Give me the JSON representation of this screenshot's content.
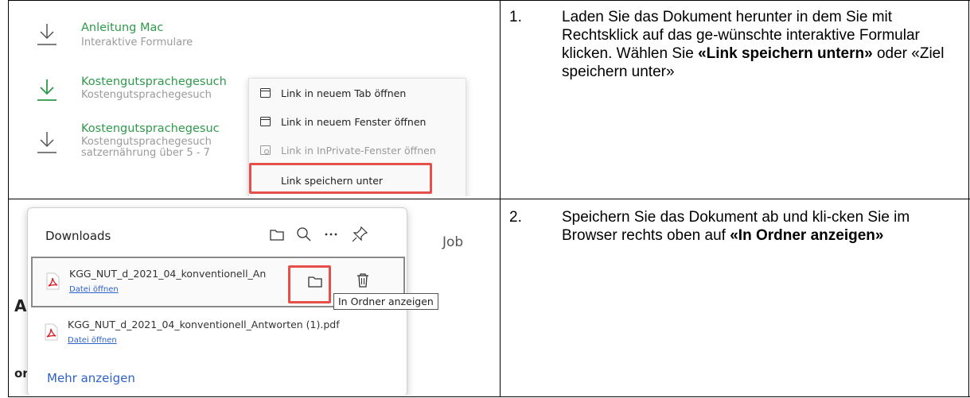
{
  "step1": {
    "downloads": [
      {
        "title": "Anleitung Mac",
        "subtitle": "Interaktive Formulare"
      },
      {
        "title": "Kostengutsprachegesuch",
        "subtitle": "Kostengutsprachegesuch"
      },
      {
        "title": "Kostengutsprachegesuc",
        "subtitle": "Kostengutsprachegesuch",
        "subtitle2": "satzernährung über 5 - 7"
      }
    ],
    "context_menu": [
      {
        "label": "Link in neuem Tab öffnen",
        "icon": "tab-icon"
      },
      {
        "label": "Link in neuem Fenster öffnen",
        "icon": "window-icon"
      },
      {
        "label": "Link in InPrivate-Fenster öffnen",
        "icon": "inprivate-icon"
      },
      {
        "label": "Link speichern unter",
        "icon": "none"
      }
    ],
    "number": "1.",
    "text_before": "Laden Sie das Dokument herunter in dem Sie mit Rechtsklick auf das ge-wünschte interaktive Formular klicken. Wählen Sie ",
    "text_bold": "«Link speichern untern»",
    "text_after": " oder «Ziel speichern unter»"
  },
  "step2": {
    "bg_job": "Job",
    "panel_title": "Downloads",
    "items": [
      {
        "filename": "KGG_NUT_d_2021_04_konventionell_An",
        "link": "Datei öffnen"
      },
      {
        "filename": "KGG_NUT_d_2021_04_konventionell_Antworten (1).pdf",
        "link": "Datei öffnen"
      }
    ],
    "tooltip": "In Ordner anzeigen",
    "more": "Mehr anzeigen",
    "number": "2.",
    "text": "Speichern Sie das Dokument ab und kli-cken Sie im Browser rechts oben auf ",
    "text_bold": "«In Ordner anzeigen»"
  },
  "colors": {
    "green": "#2c9a4a",
    "highlight": "#e5504a",
    "link": "#2d62c8"
  }
}
